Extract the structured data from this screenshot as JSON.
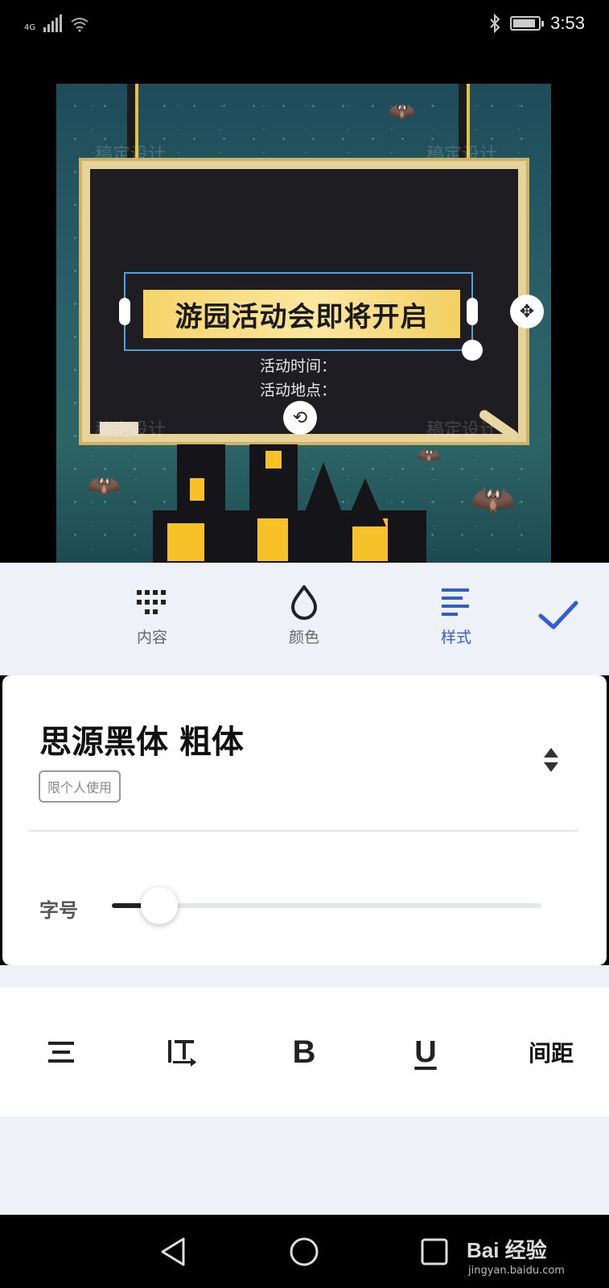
{
  "status_bar": {
    "network": "4G",
    "time": "3:53",
    "icons": [
      "signal-icon",
      "wifi-icon",
      "bluetooth-icon",
      "battery-icon"
    ]
  },
  "poster": {
    "title": "游园活动会即将开启",
    "line1": "活动时间：",
    "line2": "活动地点：",
    "watermark": "稿定设计"
  },
  "toolbar": {
    "tabs": [
      {
        "label": "内容",
        "icon": "grid-dots-icon"
      },
      {
        "label": "颜色",
        "icon": "droplet-icon"
      },
      {
        "label": "样式",
        "icon": "text-align-icon",
        "active": true
      }
    ],
    "confirm_icon": "checkmark-icon",
    "accent_color": "#2f5fd8"
  },
  "font_panel": {
    "font_name": "思源黑体 粗体",
    "license_tag": "限个人使用",
    "size_label": "字号",
    "size_fraction": 0.11
  },
  "style_row": {
    "buttons": [
      "align-center-icon",
      "vertical-text-icon",
      "bold-icon",
      "underline-icon"
    ],
    "bold_glyph": "B",
    "underline_glyph": "U",
    "spacing_label": "间距"
  },
  "nav_bar": {
    "buttons": [
      "back-icon",
      "home-icon",
      "recents-icon"
    ],
    "watermark": "Bai  经验",
    "watermark_sub": "jingyan.baidu.com"
  }
}
